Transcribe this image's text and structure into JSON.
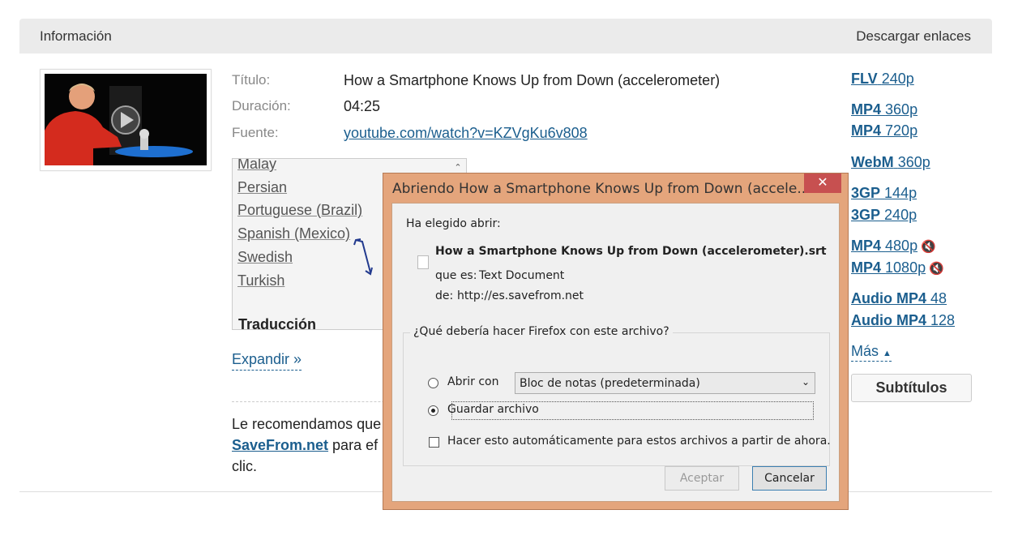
{
  "header": {
    "left_label": "Información",
    "right_label": "Descargar enlaces"
  },
  "video": {
    "title_label": "Título:",
    "title": "How a Smartphone Knows Up from Down (accelerometer)",
    "duration_label": "Duración:",
    "duration": "04:25",
    "source_label": "Fuente:",
    "source": "youtube.com/watch?v=KZVgKu6v808"
  },
  "subtitle_list": {
    "items": [
      "Malay",
      "Persian",
      "Portuguese (Brazil)",
      "Spanish (Mexico)",
      "Swedish",
      "Turkish"
    ],
    "section_heading": "Traducción"
  },
  "expand_label": "Expandir »",
  "recommendation": {
    "line1": "Le recomendamos que",
    "brand": "SaveFrom.net",
    "line2_rest": " para ef",
    "line3": "clic."
  },
  "downloads": [
    {
      "format": "FLV",
      "quality": "240p",
      "muted": false
    },
    {
      "format": "MP4",
      "quality": "360p",
      "muted": false
    },
    {
      "format": "MP4",
      "quality": "720p",
      "muted": false
    },
    {
      "format": "WebM",
      "quality": "360p",
      "muted": false
    },
    {
      "format": "3GP",
      "quality": "144p",
      "muted": false
    },
    {
      "format": "3GP",
      "quality": "240p",
      "muted": false
    },
    {
      "format": "MP4",
      "quality": "480p",
      "muted": true
    },
    {
      "format": "MP4",
      "quality": "1080p",
      "muted": true
    },
    {
      "format": "Audio MP4",
      "quality": "48",
      "muted": false
    },
    {
      "format": "Audio MP4",
      "quality": "128",
      "muted": false
    }
  ],
  "more_label": "Más",
  "subtitles_button": "Subtítulos",
  "dialog": {
    "title": "Abriendo How a Smartphone Knows Up from Down (accele...",
    "close_glyph": "✕",
    "chosen_label": "Ha elegido abrir:",
    "filename": "How a Smartphone Knows Up from Down (accelerometer).srt",
    "type_label": "que es:",
    "type_value": "Text Document",
    "from_label": "de:",
    "from_value": "http://es.savefrom.net",
    "question": "¿Qué debería hacer Firefox con este archivo?",
    "open_with_label": "Abrir con",
    "open_with_app": "Bloc de notas (predeterminada)",
    "save_label": "Guardar archivo",
    "selected_option": "save",
    "auto_label": "Hacer esto automáticamente para estos archivos a partir de ahora.",
    "auto_checked": false,
    "ok_label": "Aceptar",
    "ok_enabled": false,
    "cancel_label": "Cancelar"
  },
  "colors": {
    "link": "#1b5e8e",
    "dialog_frame": "#e4a57c",
    "close_button": "#c75050"
  }
}
